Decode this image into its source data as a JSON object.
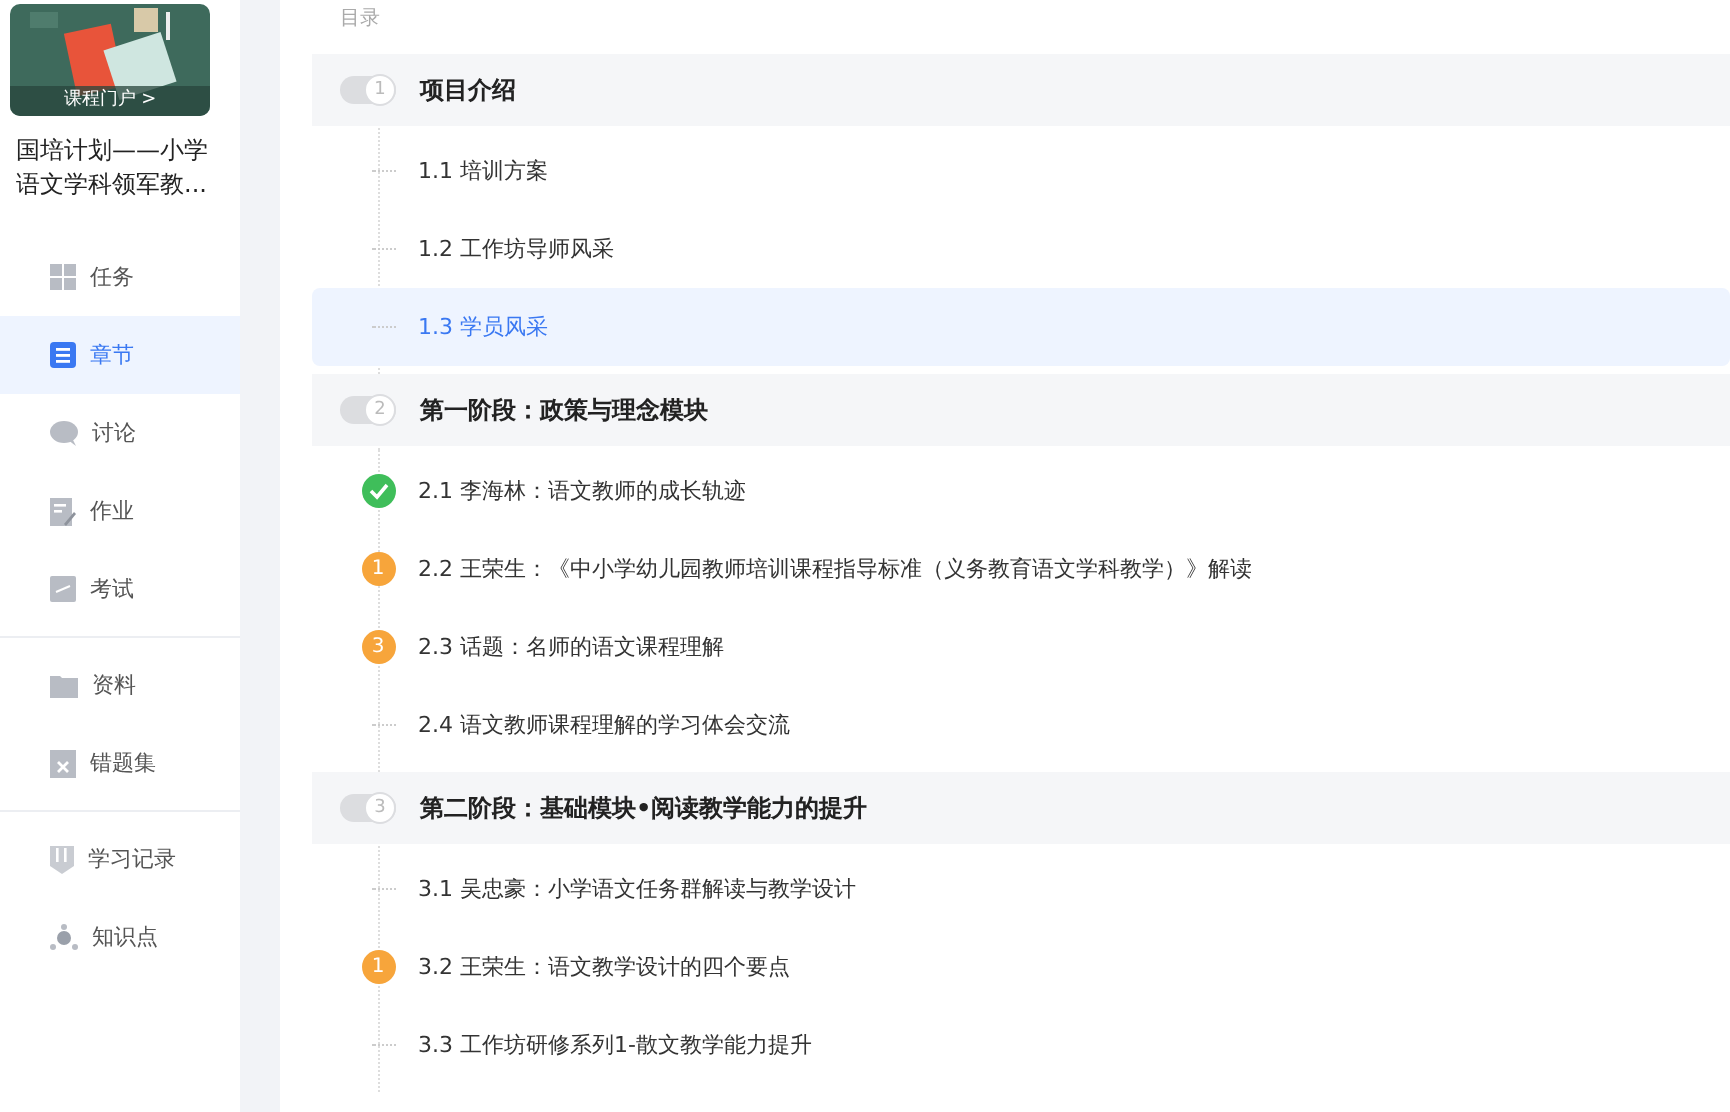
{
  "sidebar": {
    "cover": {
      "kind": "picture",
      "link": "课程门户 >"
    },
    "course_title": "国培计划——小学语文学科领军教...",
    "groups": [
      [
        {
          "label": "任务",
          "selected": false
        },
        {
          "label": "章节",
          "selected": true
        },
        {
          "label": "讨论",
          "selected": false
        },
        {
          "label": "作业",
          "selected": false
        },
        {
          "label": "考试",
          "selected": false
        }
      ],
      [
        {
          "label": "资料",
          "selected": false
        },
        {
          "label": "错题集",
          "selected": false
        }
      ],
      [
        {
          "label": "学习记录",
          "selected": false
        },
        {
          "label": "知识点",
          "selected": false
        }
      ]
    ]
  },
  "contents": {
    "heading": "目录",
    "sections": [
      {
        "number": "1",
        "title": "项目介绍",
        "items": [
          {
            "title": "1.1 培训方案",
            "kind": "none",
            "selected": false
          },
          {
            "title": "1.2 工作坊导师风采",
            "kind": "none",
            "selected": false
          },
          {
            "title": "1.3 学员风采",
            "kind": "none",
            "selected": true
          }
        ]
      },
      {
        "number": "2",
        "title": "第一阶段：政策与理念模块",
        "items": [
          {
            "title": "2.1 李海林：语文教师的成长轨迹",
            "kind": "done",
            "selected": false
          },
          {
            "title": "2.2 王荣生：《中小学幼儿园教师培训课程指导标准（义务教育语文学科教学）》解读",
            "kind": "count",
            "badge": "1",
            "selected": false
          },
          {
            "title": "2.3 话题：名师的语文课程理解",
            "kind": "count",
            "badge": "3",
            "selected": false
          },
          {
            "title": "2.4 语文教师课程理解的学习体会交流",
            "kind": "none",
            "selected": false
          }
        ]
      },
      {
        "number": "3",
        "title": "第二阶段：基础模块•阅读教学能力的提升",
        "items": [
          {
            "title": "3.1 吴忠豪：小学语文任务群解读与教学设计",
            "kind": "none",
            "selected": false
          },
          {
            "title": "3.2 王荣生：语文教学设计的四个要点",
            "kind": "count",
            "badge": "1",
            "selected": false
          },
          {
            "title": "3.3 工作坊研修系列1-散文教学能力提升",
            "kind": "none",
            "selected": false
          }
        ]
      }
    ]
  }
}
